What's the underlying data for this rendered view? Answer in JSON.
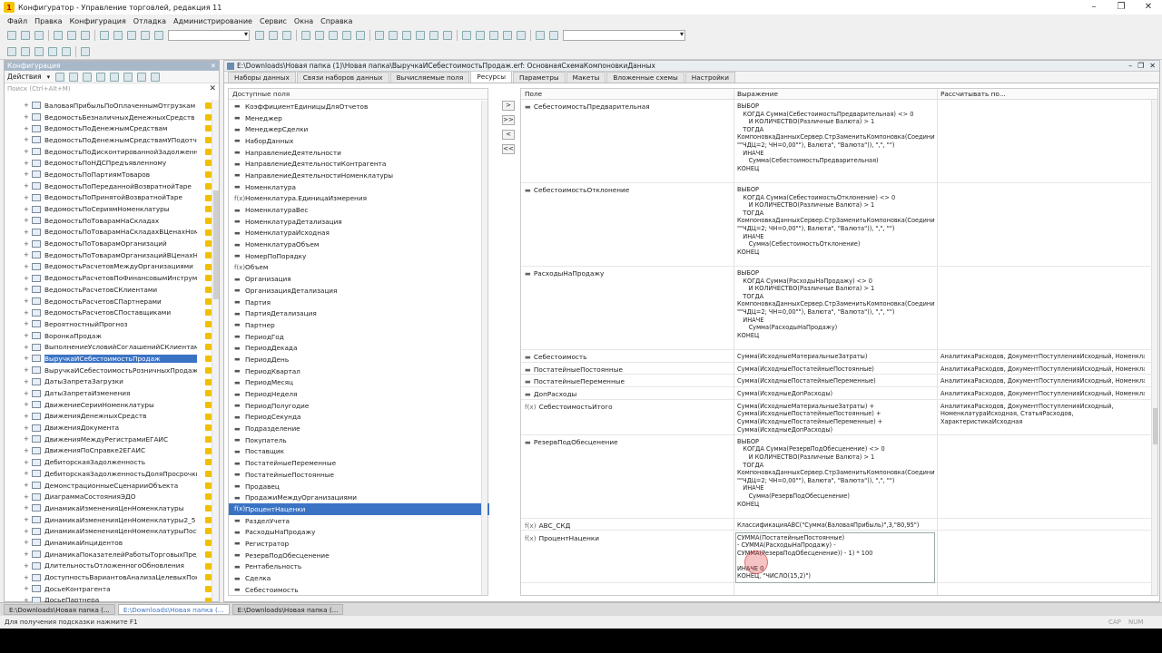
{
  "window": {
    "title": "Конфигуратор - Управление торговлей, редакция 11"
  },
  "menu": [
    "Файл",
    "Правка",
    "Конфигурация",
    "Отладка",
    "Администрирование",
    "Сервис",
    "Окна",
    "Справка"
  ],
  "config_panel": {
    "title": "Конфигурация",
    "actions_label": "Действия",
    "search_placeholder": "Поиск (Ctrl+Alt+M)",
    "items": [
      "ВаловаяПрибыльПоОплаченнымОтгрузкам",
      "ВедомостьБезналичныхДенежныхСредств",
      "ВедомостьПоДенежнымСредствам",
      "ВедомостьПоДенежнымСредствамУПодотчет...",
      "ВедомостьПоДисконтированнойЗадолженности",
      "ВедомостьПоНДСПредъявленному",
      "ВедомостьПоПартиямТоваров",
      "ВедомостьПоПереданнойВозвратнойТаре",
      "ВедомостьПоПринятойВозвратнойТаре",
      "ВедомостьПоСериямНоменклатуры",
      "ВедомостьПоТоварамНаСкладах",
      "ВедомостьПоТоварамНаСкладахВЦенахНомен...",
      "ВедомостьПоТоварамОрганизаций",
      "ВедомостьПоТоварамОрганизацийВЦенахНом...",
      "ВедомостьРасчетовМеждуОрганизациями",
      "ВедомостьРасчетовПоФинансовымИнструмен...",
      "ВедомостьРасчетовСКлиентами",
      "ВедомостьРасчетовСПартнерами",
      "ВедомостьРасчетовСПоставщиками",
      "ВероятностныйПрогноз",
      "ВоронкаПродаж",
      "ВыполнениеУсловийСоглашенийСКлиентами",
      "ВыручкаИСебестоимостьПродаж",
      "ВыручкаИСебестоимостьРозничныхПродаж",
      "ДатыЗапретаЗагрузки",
      "ДатыЗапретаИзменения",
      "ДвижениеСерииНоменклатуры",
      "ДвиженияДенежныхСредств",
      "ДвиженияДокумента",
      "ДвиженияМеждуРегистрамиЕГАИС",
      "ДвиженияПоСправке2ЕГАИС",
      "ДебиторскаяЗадолженность",
      "ДебиторскаяЗадолженностьДоляПросрочки",
      "ДемонстрационныеСценарииОбъекта",
      "ДиаграммаСостоянияЭДО",
      "ДинамикаИзмененияЦенНоменклатуры",
      "ДинамикаИзмененияЦенНоменклатуры2_5",
      "ДинамикаИзмененияЦенНоменклатурыПоста...",
      "ДинамикаИнцидентов",
      "ДинамикаПоказателейРаботыТорговыхПредс...",
      "ДлительностьОтложенногоОбновления",
      "ДоступностьВариантовАнализаЦелевыхПоказ...",
      "ДосьеКонтрагента",
      "ДосьеПартнера"
    ],
    "selected_index": 22
  },
  "editor": {
    "title": "E:\\Downloads\\Новая папка (1)\\Новая папка\\ВыручкаИСебестоимостьПродаж.erf: ОсновнаяСхемаКомпоновкиДанных",
    "tabs": [
      "Наборы данных",
      "Связи наборов данных",
      "Вычисляемые поля",
      "Ресурсы",
      "Параметры",
      "Макеты",
      "Вложенные схемы",
      "Настройки"
    ],
    "active_tab": 3,
    "available_header": "Доступные поля",
    "available_fields": [
      {
        "m": "▬",
        "t": "КоэффициентЕдиницыДляОтчетов"
      },
      {
        "m": "▬",
        "t": "Менеджер"
      },
      {
        "m": "▬",
        "t": "МенеджерСделки"
      },
      {
        "m": "▬",
        "t": "НаборДанных"
      },
      {
        "m": "▬",
        "t": "НаправлениеДеятельности"
      },
      {
        "m": "▬",
        "t": "НаправлениеДеятельностиКонтрагента"
      },
      {
        "m": "▬",
        "t": "НаправлениеДеятельностиНоменклатуры"
      },
      {
        "m": "▬",
        "t": "Номенклатура"
      },
      {
        "m": "f(x)",
        "t": "Номенклатура.ЕдиницаИзмерения"
      },
      {
        "m": "▬",
        "t": "НоменклатураВес"
      },
      {
        "m": "▬",
        "t": "НоменклатураДетализация"
      },
      {
        "m": "▬",
        "t": "НоменклатураИсходная"
      },
      {
        "m": "▬",
        "t": "НоменклатураОбъем"
      },
      {
        "m": "▬",
        "t": "НомерПоПорядку"
      },
      {
        "m": "f(x)",
        "t": "Объем"
      },
      {
        "m": "▬",
        "t": "Организация"
      },
      {
        "m": "▬",
        "t": "ОрганизацияДетализация"
      },
      {
        "m": "▬",
        "t": "Партия"
      },
      {
        "m": "▬",
        "t": "ПартияДетализация"
      },
      {
        "m": "▬",
        "t": "Партнер"
      },
      {
        "m": "▬",
        "t": "ПериодГод"
      },
      {
        "m": "▬",
        "t": "ПериодДекада"
      },
      {
        "m": "▬",
        "t": "ПериодДень"
      },
      {
        "m": "▬",
        "t": "ПериодКвартал"
      },
      {
        "m": "▬",
        "t": "ПериодМесяц"
      },
      {
        "m": "▬",
        "t": "ПериодНеделя"
      },
      {
        "m": "▬",
        "t": "ПериодПолугодие"
      },
      {
        "m": "▬",
        "t": "ПериодСекунда"
      },
      {
        "m": "▬",
        "t": "Подразделение"
      },
      {
        "m": "▬",
        "t": "Покупатель"
      },
      {
        "m": "▬",
        "t": "Поставщик"
      },
      {
        "m": "▬",
        "t": "ПостатейныеПеременные"
      },
      {
        "m": "▬",
        "t": "ПостатейныеПостоянные"
      },
      {
        "m": "▬",
        "t": "Продавец"
      },
      {
        "m": "▬",
        "t": "ПродажиМеждуОрганизациями"
      },
      {
        "m": "f(x)",
        "t": "ПроцентНаценки"
      },
      {
        "m": "▬",
        "t": "РазделУчета"
      },
      {
        "m": "▬",
        "t": "РасходыНаПродажу"
      },
      {
        "m": "▬",
        "t": "Регистратор"
      },
      {
        "m": "▬",
        "t": "РезервПодОбесценение"
      },
      {
        "m": "▬",
        "t": "Рентабельность"
      },
      {
        "m": "▬",
        "t": "Сделка"
      },
      {
        "m": "▬",
        "t": "Себестоимость"
      }
    ],
    "available_selected": 35,
    "arrow_buttons": [
      ">",
      ">>",
      "<",
      "<<"
    ],
    "columns": [
      "Поле",
      "Выражение",
      "Рассчитывать по..."
    ],
    "resources": [
      {
        "m": "▬",
        "field": "СебестоимостьПредварительная",
        "expr": "ВЫБОР\n   КОГДА Сумма(СебестоимостьПредварительная) <> 0\n      И КОЛИЧЕСТВО(Различные Валюта) > 1\n   ТОГДА\nКомпоновкаДанныхСервер.СтрЗаменитьКомпоновка(Соединит\n\"\"ЧДЦ=2; ЧН=0,00\"\"), Валюта\", \"Валюта\")), \",\", \"\")\n   ИНАЧЕ\n      Сумма(СебестоимостьПредварительная)\nКОНЕЦ",
        "calc": "",
        "height": 91
      },
      {
        "m": "▬",
        "field": "СебестоимостьОтклонение",
        "expr": "ВЫБОР\n   КОГДА Сумма(СебестоимостьОтклонение) <> 0\n      И КОЛИЧЕСТВО(Различные Валюта) > 1\n   ТОГДА\nКомпоновкаДанныхСервер.СтрЗаменитьКомпоновка(Соединит\n\"\"ЧДЦ=2; ЧН=0,00\"\"), Валюта\", \"Валюта\")), \",\", \"\")\n   ИНАЧЕ\n      Сумма(СебестоимостьОтклонение)\nКОНЕЦ",
        "calc": "",
        "height": 91
      },
      {
        "m": "▬",
        "field": "РасходыНаПродажу",
        "expr": "ВЫБОР\n   КОГДА Сумма(РасходыНаПродажу) <> 0\n      И КОЛИЧЕСТВО(Различные Валюта) > 1\n   ТОГДА\nКомпоновкаДанныхСервер.СтрЗаменитьКомпоновка(Соединит\n\"\"ЧДЦ=2; ЧН=0,00\"\"), Валюта\", \"Валюта\")), \",\", \"\")\n   ИНАЧЕ\n      Сумма(РасходыНаПродажу)\nКОНЕЦ",
        "calc": "",
        "height": 91
      },
      {
        "m": "▬",
        "field": "Себестоимость",
        "expr": "Сумма(ИсходныеМатериальныеЗатраты)",
        "calc": "АналитикаРасходов, ДокументПоступленияИсходный, Номенкла...",
        "height": 12.7
      },
      {
        "m": "▬",
        "field": "ПостатейныеПостоянные",
        "expr": "Сумма(ИсходныеПостатейныеПостоянные)",
        "calc": "АналитикаРасходов, ДокументПоступленияИсходный, Номенкла...",
        "height": 12.7
      },
      {
        "m": "▬",
        "field": "ПостатейныеПеременные",
        "expr": "Сумма(ИсходныеПостатейныеПеременные)",
        "calc": "АналитикаРасходов, ДокументПоступленияИсходный, Номенкла...",
        "height": 12.7
      },
      {
        "m": "▬",
        "field": "ДопРасходы",
        "expr": "Сумма(ИсходныеДопРасходы)",
        "calc": "АналитикаРасходов, ДокументПоступленияИсходный, Номенкла...",
        "height": 12.7
      },
      {
        "m": "f(x)",
        "field": "СебестоимостьИтого",
        "expr": "Сумма(ИсходныеМатериальныеЗатраты) +\nСумма(ИсходныеПостатейныеПостоянные) +\nСумма(ИсходныеПостатейныеПеременные) +\nСумма(ИсходныеДопРасходы)",
        "calc": "АналитикаРасходов, ДокументПоступленияИсходный,\nНоменклатураИсходная, СтатьяРасходов,\nХарактеристикаИсходная",
        "height": 38
      },
      {
        "m": "▬",
        "field": "РезервПодОбесценение",
        "expr": "ВЫБОР\n   КОГДА Сумма(РезервПодОбесценение) <> 0\n      И КОЛИЧЕСТВО(Различные Валюта) > 1\n   ТОГДА\nКомпоновкаДанныхСервер.СтрЗаменитьКомпоновка(Соединит\n\"\"ЧДЦ=2; ЧН=0,00\"\"), Валюта\", \"Валюта\")), \",\", \"\")\n   ИНАЧЕ\n      Сумма(РезервПодОбесценение)\nКОНЕЦ",
        "calc": "",
        "height": 91
      },
      {
        "m": "f(x)",
        "field": "АВС_СКД",
        "expr": "КлассификацияABC(\"Сумма(ВаловаяПрибыль)\",3,\"80,95\")",
        "calc": "",
        "height": 12.7
      },
      {
        "m": "f(x)",
        "field": "ПроцентНаценки",
        "expr": "СУММА(ПостатейныеПостоянные)\n- СУММА(РасходыНаПродажу) -\nСУММА(РезервПодОбесценение)) - 1) * 100\n\nИНАЧЕ 0\nКОНЕЦ, \"ЧИСЛО(15,2)\")",
        "calc": "",
        "height": 56
      }
    ]
  },
  "window_tabs": [
    "E:\\Downloads\\Новая папка (...",
    "E:\\Downloads\\Новая папка (...",
    "E:\\Downloads\\Новая папка (..."
  ],
  "active_window_tab": 1,
  "status": {
    "hint": "Для получения подсказки нажмите F1",
    "cap": "CAP",
    "num": "NUM"
  }
}
